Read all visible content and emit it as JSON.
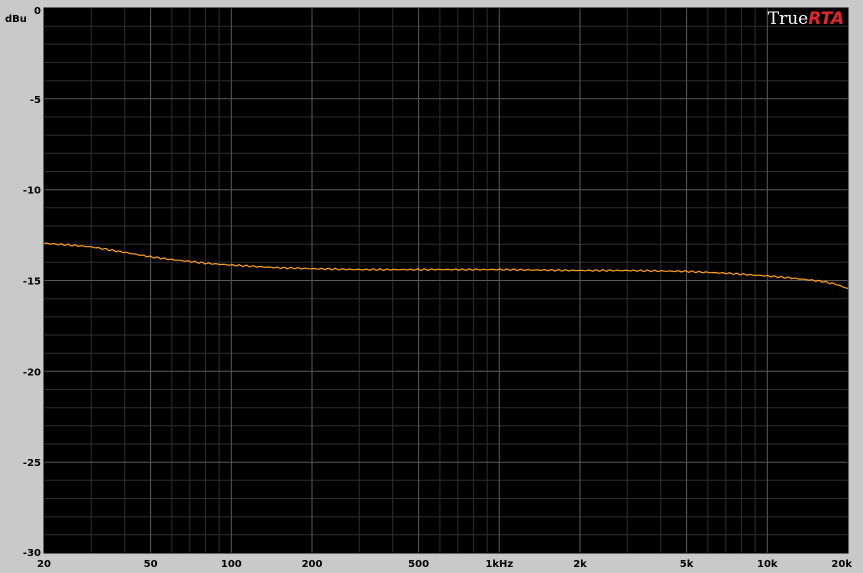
{
  "brand": {
    "part1": "True",
    "part2": "RTA",
    "accent_color": "#e0262c"
  },
  "colors": {
    "background": "#c9c9c9",
    "plot_background": "#000000",
    "grid_major": "#5a5a5a",
    "grid_minor": "#2e2e2e",
    "trace": "#ffa020"
  },
  "chart_data": {
    "type": "line",
    "ylabel": "dBu",
    "xlabel": "",
    "x_scale": "log",
    "xlim": [
      20,
      20000
    ],
    "ylim": [
      -30,
      0
    ],
    "grid": true,
    "y_ticks": [
      {
        "value": 0,
        "label": "0"
      },
      {
        "value": -5,
        "label": "-5"
      },
      {
        "value": -10,
        "label": "-10"
      },
      {
        "value": -15,
        "label": "-15"
      },
      {
        "value": -20,
        "label": "-20"
      },
      {
        "value": -25,
        "label": "-25"
      },
      {
        "value": -30,
        "label": "-30"
      }
    ],
    "x_ticks": [
      {
        "value": 20,
        "label": "20"
      },
      {
        "value": 50,
        "label": "50"
      },
      {
        "value": 100,
        "label": "100"
      },
      {
        "value": 200,
        "label": "200"
      },
      {
        "value": 500,
        "label": "500"
      },
      {
        "value": 1000,
        "label": "1kHz"
      },
      {
        "value": 2000,
        "label": "2k"
      },
      {
        "value": 5000,
        "label": "5k"
      },
      {
        "value": 10000,
        "label": "10k"
      },
      {
        "value": 20000,
        "label": "20k"
      }
    ],
    "series": [
      {
        "color": "#ffa020",
        "x": [
          20,
          25,
          30,
          40,
          50,
          60,
          70,
          80,
          100,
          130,
          150,
          200,
          300,
          500,
          1000,
          2000,
          3000,
          5000,
          7000,
          10000,
          12000,
          14000,
          16000,
          18000,
          20000
        ],
        "y": [
          -12.95,
          -13.05,
          -13.15,
          -13.45,
          -13.7,
          -13.85,
          -13.95,
          -14.05,
          -14.15,
          -14.25,
          -14.3,
          -14.35,
          -14.4,
          -14.4,
          -14.4,
          -14.45,
          -14.45,
          -14.5,
          -14.6,
          -14.75,
          -14.85,
          -14.95,
          -15.05,
          -15.2,
          -15.45
        ]
      }
    ]
  }
}
